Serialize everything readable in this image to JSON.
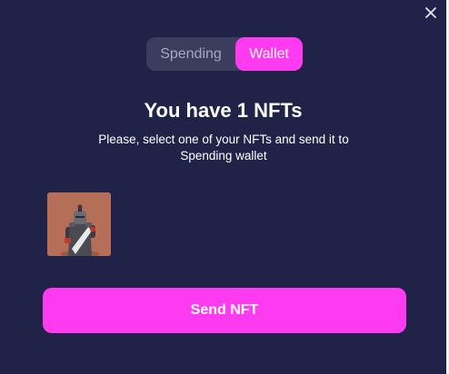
{
  "modal": {
    "close_icon": "close-icon"
  },
  "toggle": {
    "tabs": [
      {
        "label": "Spending",
        "active": false
      },
      {
        "label": "Wallet",
        "active": true
      }
    ]
  },
  "content": {
    "title": "You have 1 NFTs",
    "subtitle": "Please, select one of your NFTs and send it to Spending wallet"
  },
  "nfts": [
    {
      "image": "knight-character-nft"
    }
  ],
  "actions": {
    "send_label": "Send NFT"
  },
  "colors": {
    "background": "#212248",
    "accent": "#ff3bf2",
    "toggle_bg": "#3b3c5e",
    "inactive_tab_text": "#a6a8c2",
    "nft_bg": "#b56e57"
  }
}
